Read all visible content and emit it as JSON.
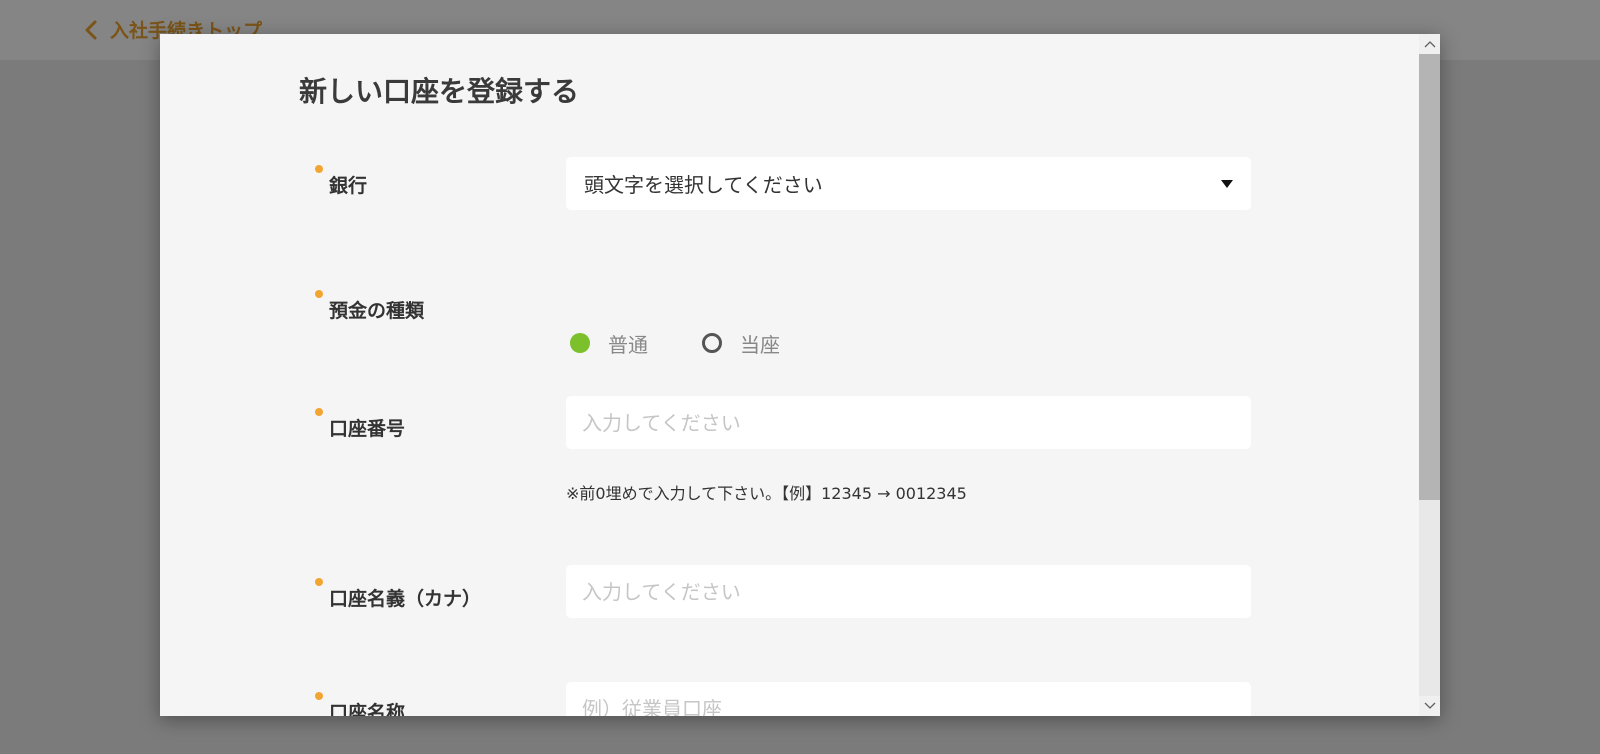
{
  "background": {
    "back_link_label": "入社手続きトップ"
  },
  "modal": {
    "title": "新しい口座を登録する",
    "bank": {
      "label": "銀行",
      "select_value": "頭文字を選択してください"
    },
    "deposit_type": {
      "label": "預金の種類",
      "options": [
        {
          "label": "普通",
          "checked": true
        },
        {
          "label": "当座",
          "checked": false
        }
      ]
    },
    "account_number": {
      "label": "口座番号",
      "placeholder": "入力してください",
      "hint": "※前0埋めで入力して下さい。【例】12345 → 0012345"
    },
    "account_holder_kana": {
      "label": "口座名義（カナ）",
      "placeholder": "入力してください"
    },
    "account_name": {
      "label": "口座名称",
      "placeholder": "例）従業員口座"
    }
  },
  "colors": {
    "required_dot": "#f2a531",
    "radio_checked": "#7cc02b",
    "back_link": "#7a5418"
  },
  "icons": {
    "back": "chevron-left-icon",
    "select": "caret-down-icon",
    "scroll_up": "chevron-up-icon",
    "scroll_down": "chevron-down-icon"
  }
}
